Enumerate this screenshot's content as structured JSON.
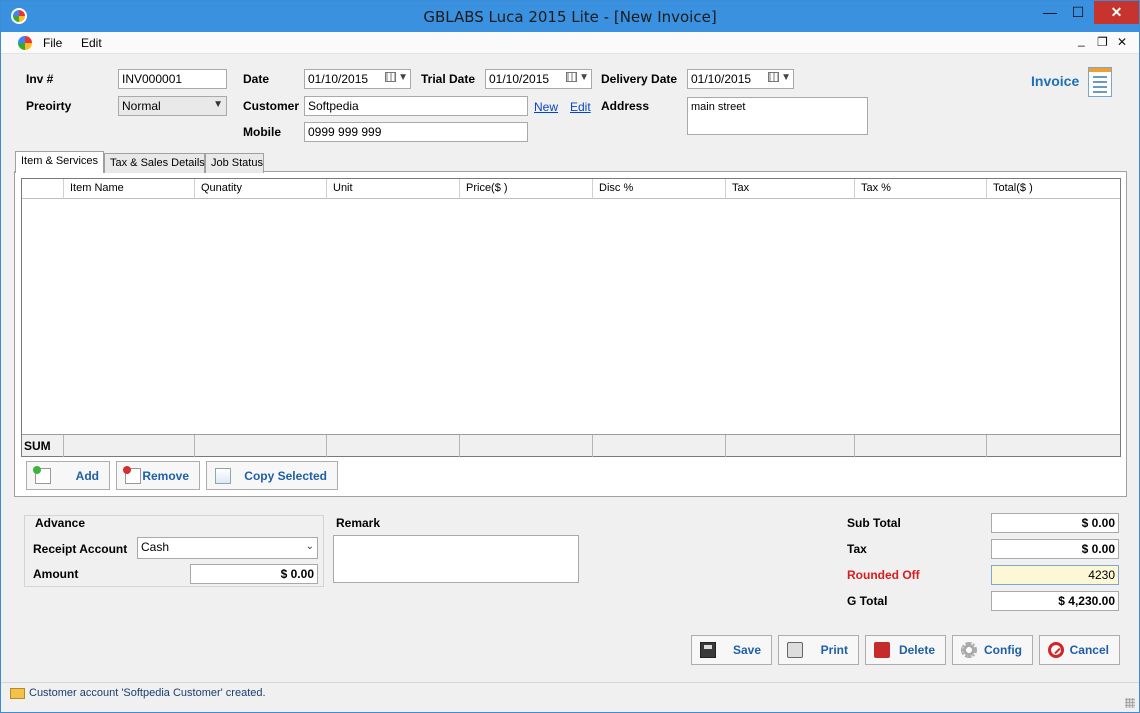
{
  "window": {
    "title": "GBLABS Luca 2015 Lite - [New Invoice]",
    "minimize": "—",
    "maximize": "☐",
    "close": "✕"
  },
  "menu": {
    "file": "File",
    "edit": "Edit",
    "mdi_minimize": "_",
    "mdi_restore": "❐",
    "mdi_close": "✕"
  },
  "form": {
    "inv_label": "Inv #",
    "inv_value": "INV000001",
    "priority_label": "Preoirty",
    "priority_value": "Normal",
    "date_label": "Date",
    "date_value": "01/10/2015",
    "trial_label": "Trial Date",
    "trial_value": "01/10/2015",
    "delivery_label": "Delivery Date",
    "delivery_value": "01/10/2015",
    "customer_label": "Customer",
    "customer_value": "Softpedia",
    "new_link": "New",
    "edit_link": "Edit",
    "mobile_label": "Mobile",
    "mobile_value": "0999 999 999",
    "address_label": "Address",
    "address_value": "main street",
    "invoice_heading": "Invoice"
  },
  "tabs": [
    "Item & Services",
    "Tax & Sales Details",
    "Job Status"
  ],
  "grid": {
    "columns": [
      "",
      "Item Name",
      "Qunatity",
      "Unit",
      "Price($ )",
      "Disc %",
      "Tax",
      "Tax %",
      "Total($ )"
    ],
    "sum_label": "SUM"
  },
  "item_buttons": {
    "add": "Add",
    "remove": "Remove",
    "copy": "Copy Selected"
  },
  "advance": {
    "heading": "Advance",
    "receipt_label": "Receipt Account",
    "receipt_value": "Cash",
    "amount_label": "Amount",
    "amount_value": "$  0.00"
  },
  "remark": {
    "label": "Remark"
  },
  "totals": {
    "subtotal_label": "Sub Total",
    "subtotal_value": "$  0.00",
    "tax_label": "Tax",
    "tax_value": "$  0.00",
    "rounded_label": "Rounded Off",
    "rounded_value": "4230",
    "gtotal_label": "G Total",
    "gtotal_value": "$  4,230.00"
  },
  "actions": {
    "save": "Save",
    "print": "Print",
    "delete": "Delete",
    "config": "Config",
    "cancel": "Cancel"
  },
  "status": {
    "message": "Customer account 'Softpedia Customer' created."
  },
  "colors": {
    "titlebar": "#3a91e0",
    "link": "#0645c8",
    "button_text": "#1f5fa8",
    "rounded_highlight": "#fcf8d6",
    "rounded_label": "#d61e1e"
  }
}
